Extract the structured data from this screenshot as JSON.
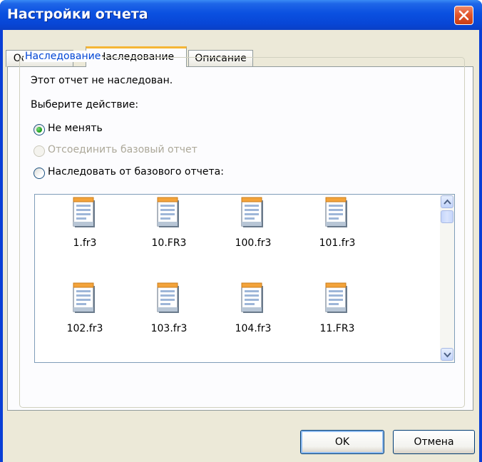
{
  "window": {
    "title": "Настройки отчета"
  },
  "tabs": [
    {
      "label": "Основные",
      "active": false
    },
    {
      "label": "Наследование",
      "active": true
    },
    {
      "label": "Описание",
      "active": false
    }
  ],
  "inheritance": {
    "group_title": "Наследование",
    "status_text": "Этот отчет не наследован.",
    "prompt": "Выберите действие:",
    "options": [
      {
        "label": "Не менять",
        "checked": true,
        "enabled": true
      },
      {
        "label": "Отсоединить базовый отчет",
        "checked": false,
        "enabled": false
      },
      {
        "label": "Наследовать от базового отчета:",
        "checked": false,
        "enabled": true
      }
    ],
    "files": [
      "1.fr3",
      "10.FR3",
      "100.fr3",
      "101.fr3",
      "102.fr3",
      "103.fr3",
      "104.fr3",
      "11.FR3"
    ]
  },
  "buttons": {
    "ok": "OK",
    "cancel": "Отмена"
  },
  "icons": {
    "close": "close-icon",
    "file": "report-file-icon",
    "scroll_up": "chevron-up-icon",
    "scroll_down": "chevron-down-icon"
  },
  "colors": {
    "titlebar": "#0a50e0",
    "dialog_bg": "#ece9d8",
    "group_title": "#0046d5",
    "active_tab_accent": "#f5b636",
    "close_button": "#e2572c"
  }
}
